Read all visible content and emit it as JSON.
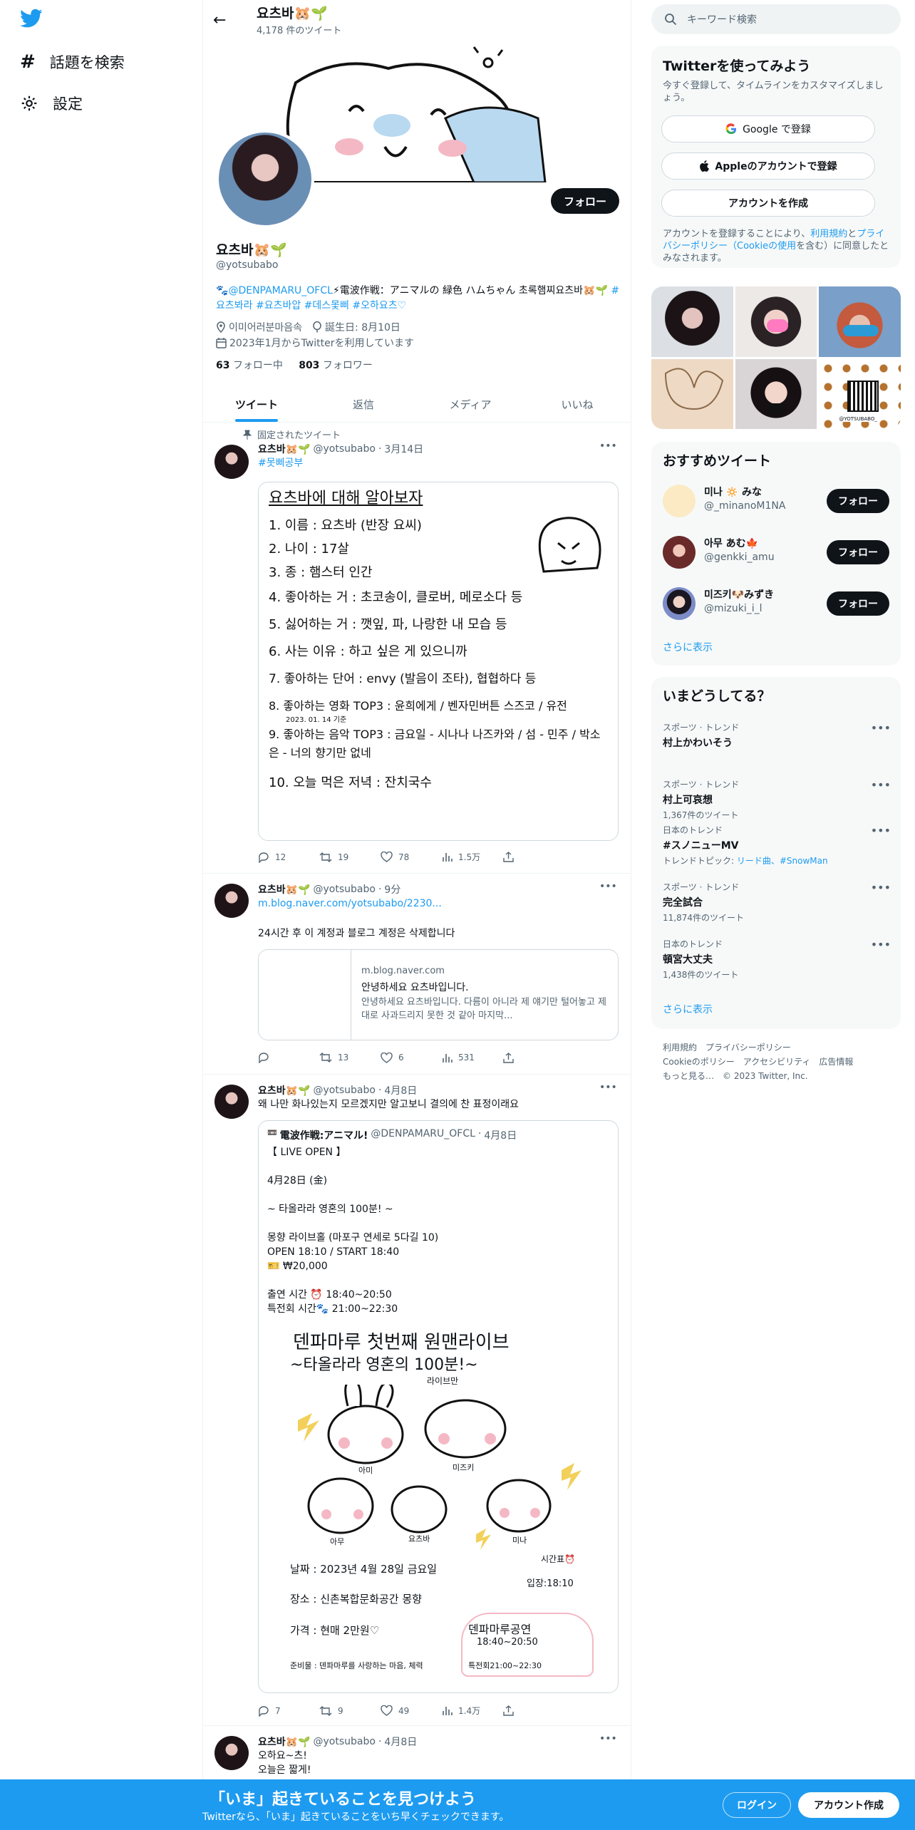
{
  "nav": {
    "explore": "話題を検索",
    "settings": "設定"
  },
  "header": {
    "name": "요츠바🐹🌱",
    "count": "4,178 件のツイート",
    "back": "←"
  },
  "profile": {
    "name": "요츠바🐹🌱",
    "handle": "@yotsubabo",
    "follow_button": "フォロー",
    "bio_parts": [
      "🐾",
      "@DENPAMARU_OFCL",
      "⚡電波作戦：アニマルの 緑色 ハムちゃん 초록햄찌요츠바🐹🌱 ",
      "#요츠봐라 #요츠바압 #데스몿삐 #오하요츠♡"
    ],
    "location": "이미어러분마음속",
    "birthday": "誕生日: 8月10日",
    "joined": "2023年1月からTwitterを利用しています",
    "following_count": "63",
    "following_label": "フォロー中",
    "followers_count": "803",
    "followers_label": "フォロワー"
  },
  "tabs": [
    "ツイート",
    "返信",
    "メディア",
    "いいね"
  ],
  "pinned_label": "固定されたツイート",
  "tweets": [
    {
      "name": "요츠바🐹🌱",
      "handle": "@yotsubabo",
      "time": "3月14日",
      "text": "#못삐공부",
      "image_lines": [
        "요츠바에 대해 알아보자",
        "1. 이름 : 요츠바 (반장 요씨)",
        "2. 나이 : 17살",
        "3. 종 : 햄스터 인간",
        "4. 좋아하는 거 : 초코송이, 클로버, 메로소다 등",
        "5. 싫어하는 거 : 깻잎, 파, 나랑한 내 모습 등",
        "6. 사는 이유 : 하고 싶은 게 있으니까",
        "7. 좋아하는 단어 : envy (발음이 조타), 협협하다 등",
        "8. 좋아하는 영화 TOP3 : 윤희에게 / 벤자민버튼 스즈코 / 유전",
        "9. 좋아하는 음악 TOP3 : 금요일 - 시나나 나즈카와 / 섬 - 민주 / 박소은 - 너의 향기만 없네",
        "10. 오늘 먹은 저녁 : 잔치국수"
      ],
      "annotation": "2023. 01. 14 기준",
      "reply": "12",
      "retweet": "19",
      "like": "78",
      "views": "1.5万"
    },
    {
      "name": "요츠바🐹🌱",
      "handle": "@yotsubabo",
      "time": "9分",
      "link": "m.blog.naver.com/yotsubabo/2230...",
      "text": "24시간 후 이 계정과 블로그 계정은 삭제합니다",
      "card_domain": "m.blog.naver.com",
      "card_title": "안녕하세요 요츠바입니다.",
      "card_desc": "안녕하세요 요츠바입니다. 다름이 아니라 제 얘기만 털어놓고 제대로 사과드리지 못한 것 같아 마지막...",
      "reply": "",
      "retweet": "13",
      "like": "6",
      "views": "531"
    },
    {
      "name": "요츠바🐹🌱",
      "handle": "@yotsubabo",
      "time": "4月8日",
      "text": "왜 나만 화나있는지 모르겠지만 알고보니 결의에 찬 표정이래요",
      "quote_name": "電波作戦:アニマル!",
      "quote_handle": "@DENPAMARU_OFCL",
      "quote_time": "4月8日",
      "quote_lines": [
        "【 LIVE OPEN 】",
        "",
        "4月28日 (金)",
        "",
        "~ 타올라라 영혼의 100분! ~",
        "",
        "몽향 라이브홀 (마포구 연세로 5다길 10)",
        "OPEN 18:10 / START 18:40",
        "🎫 ₩20,000",
        "",
        "출연 시간 ⏰ 18:40~20:50",
        "특전회 시간🐾 21:00~22:30"
      ],
      "poster": {
        "title": "덴파마루 첫번째 원맨라이브",
        "subtitle": "~타올라라 영혼의 100분!~",
        "tag": "라이브만",
        "names": [
          "아미",
          "미즈키",
          "아무",
          "요츠바",
          "미나"
        ],
        "time_label": "시간표⏰",
        "date": "날짜 : 2023년 4월 28일 금요일",
        "entry": "입장:18:10",
        "place": "장소 : 신촌복합문화공간 몽향",
        "price": "가격 : 현매 2만원♡",
        "show": "덴파마루공연",
        "show_time": "18:40~20:50",
        "special": "특전회21:00~22:30",
        "bring": "준비물 : 덴파마루를 사랑하는 마음, 체력"
      },
      "reply": "7",
      "retweet": "9",
      "like": "49",
      "views": "1.4万"
    },
    {
      "name": "요츠바🐹🌱",
      "handle": "@yotsubabo",
      "time": "4月8日",
      "text1": "오하요~츠!",
      "text2": "오늘은 짧게!"
    }
  ],
  "right": {
    "search_placeholder": "キーワード検索",
    "signup": {
      "title": "Twitterを使ってみよう",
      "desc": "今すぐ登録して、タイムラインをカスタマイズしましょう。",
      "google": "Google で登録",
      "apple": "Appleのアカウントで登録",
      "create": "アカウントを作成",
      "terms_a": "アカウントを登録することにより、",
      "terms_link1": "利用規約",
      "terms_b": "と",
      "terms_link2": "プライバシーポリシー（Cookieの使用",
      "terms_c": "を含む）に同意したとみなされます。"
    },
    "photo_grid_label": "@YOTSUBABO_",
    "reco": {
      "title": "おすすめツイート",
      "more": "さらに表示",
      "users": [
        {
          "name": "미나 🔅 みな",
          "handle": "@_minanoM1NA",
          "button": "フォロー"
        },
        {
          "name": "아무 あむ🍁",
          "handle": "@genkki_amu",
          "button": "フォロー"
        },
        {
          "name": "미즈키🐶みずき",
          "handle": "@mizuki_i_l",
          "button": "フォロー"
        }
      ]
    },
    "trends": {
      "title": "いまどうしてる？",
      "more": "さらに表示",
      "items": [
        {
          "cat": "スポーツ · トレンド",
          "title": "村上かわいそう",
          "sub": ""
        },
        {
          "cat": "スポーツ · トレンド",
          "title": "村上可哀想",
          "sub": "1,367件のツイート"
        },
        {
          "cat": "日本のトレンド",
          "title": "#スノニューMV",
          "sub": "トレンドトピック: ",
          "sub_link": "リード曲、#SnowMan"
        },
        {
          "cat": "スポーツ · トレンド",
          "title": "完全試合",
          "sub": "11,874件のツイート"
        },
        {
          "cat": "日本のトレンド",
          "title": "頓宮大丈夫",
          "sub": "1,438件のツイート"
        }
      ]
    },
    "footer": {
      "l1": "利用規約　プライバシーポリシー",
      "l2": "Cookieのポリシー　アクセシビリティ　広告情報",
      "l3": "もっと見る…　© 2023 Twitter, Inc."
    }
  },
  "bottom": {
    "title": "「いま」起きていることを見つけよう",
    "sub": "Twitterなら、「いま」起きていることをいち早くチェックできます。",
    "login": "ログイン",
    "signup": "アカウント作成"
  },
  "colors": {
    "accent": "#1d9bf0",
    "text": "#0f1419",
    "muted": "#536471"
  }
}
